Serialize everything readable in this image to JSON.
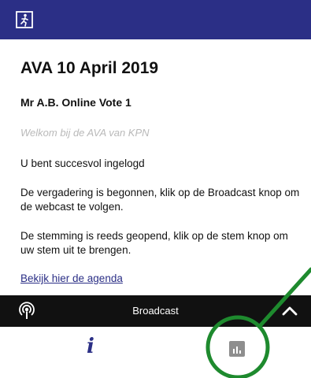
{
  "header": {
    "exit_icon": "exit-door-icon"
  },
  "main": {
    "title": "AVA 10 April 2019",
    "subtitle": "Mr A.B. Online Vote 1",
    "welcome": "Welkom bij de AVA van KPN",
    "logged_in": "U bent succesvol ingelogd",
    "meeting_started": "De vergadering is begonnen, klik op de Broadcast knop om de webcast te volgen.",
    "voting_open": "De stemming is reeds geopend, klik op de stem knop om uw stem uit te brengen.",
    "agenda_link": "Bekijk hier de agenda"
  },
  "broadcast": {
    "label": "Broadcast",
    "icon": "broadcast-icon",
    "toggle_icon": "chevron-up-icon"
  },
  "tabs": {
    "info_glyph": "i",
    "info_icon": "info-icon",
    "vote_icon": "bar-chart-icon"
  },
  "annotation": {
    "color": "#1e8a2e"
  },
  "colors": {
    "brand": "#2b2f86",
    "bar": "#111111",
    "muted": "#b9b9b9"
  }
}
